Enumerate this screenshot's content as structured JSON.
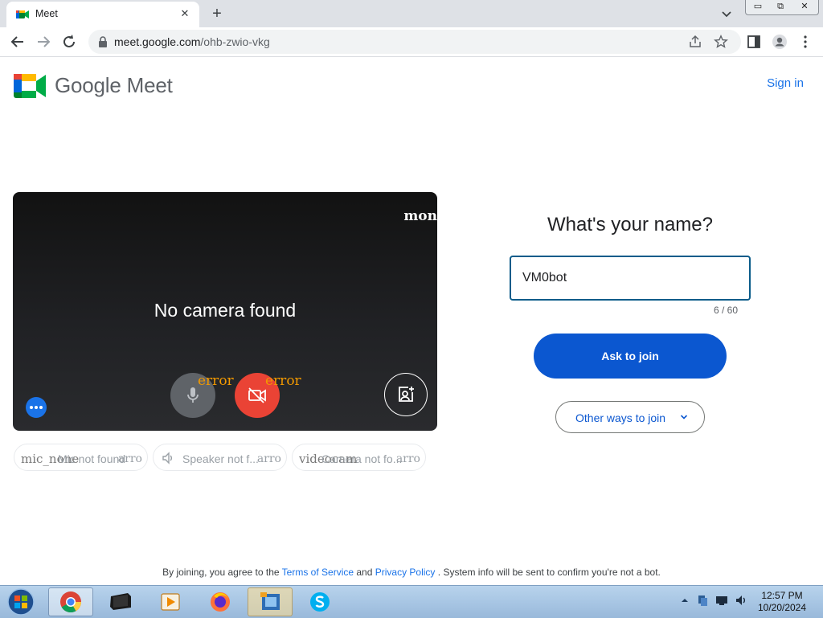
{
  "browser": {
    "tab_title": "Meet",
    "new_tab": "+",
    "close": "✕",
    "url_host": "meet.google.com",
    "url_path": "/ohb-zwio-vkg",
    "window_controls": {
      "minimize": "▭",
      "restore": "⧉",
      "close": "✕"
    }
  },
  "header": {
    "brand": "Google Meet",
    "sign_in": "Sign in"
  },
  "preview": {
    "status": "No camera found",
    "overlay_mon": "mon",
    "mic_overlay": "error",
    "cam_overlay": "error"
  },
  "device_chips": [
    {
      "overlay": "mic_none",
      "label": "Mic not found",
      "arrow": "arro"
    },
    {
      "overlay": "",
      "label": "Speaker not f...",
      "arrow": "arro"
    },
    {
      "overlay": "videocam",
      "label": "Camera not fo...",
      "arrow": "arro"
    }
  ],
  "join": {
    "question": "What's your name?",
    "name_value": "VM0bot",
    "counter": "6 / 60",
    "ask_to_join": "Ask to join",
    "other_ways": "Other ways to join"
  },
  "legal": {
    "prefix": "By joining, you agree to the",
    "terms": "Terms of Service",
    "and": "and",
    "privacy": "Privacy Policy",
    "suffix": ". System info will be sent to confirm you're not a bot."
  },
  "taskbar": {
    "apps": [
      "chrome",
      "terminal",
      "vlc",
      "firefox",
      "virtualbox",
      "skype"
    ],
    "time": "12:57 PM",
    "date": "10/20/2024"
  },
  "colors": {
    "primary": "#0b57d0",
    "link": "#1a73e8",
    "danger": "#ea4335",
    "input_border": "#0b5c8a"
  }
}
